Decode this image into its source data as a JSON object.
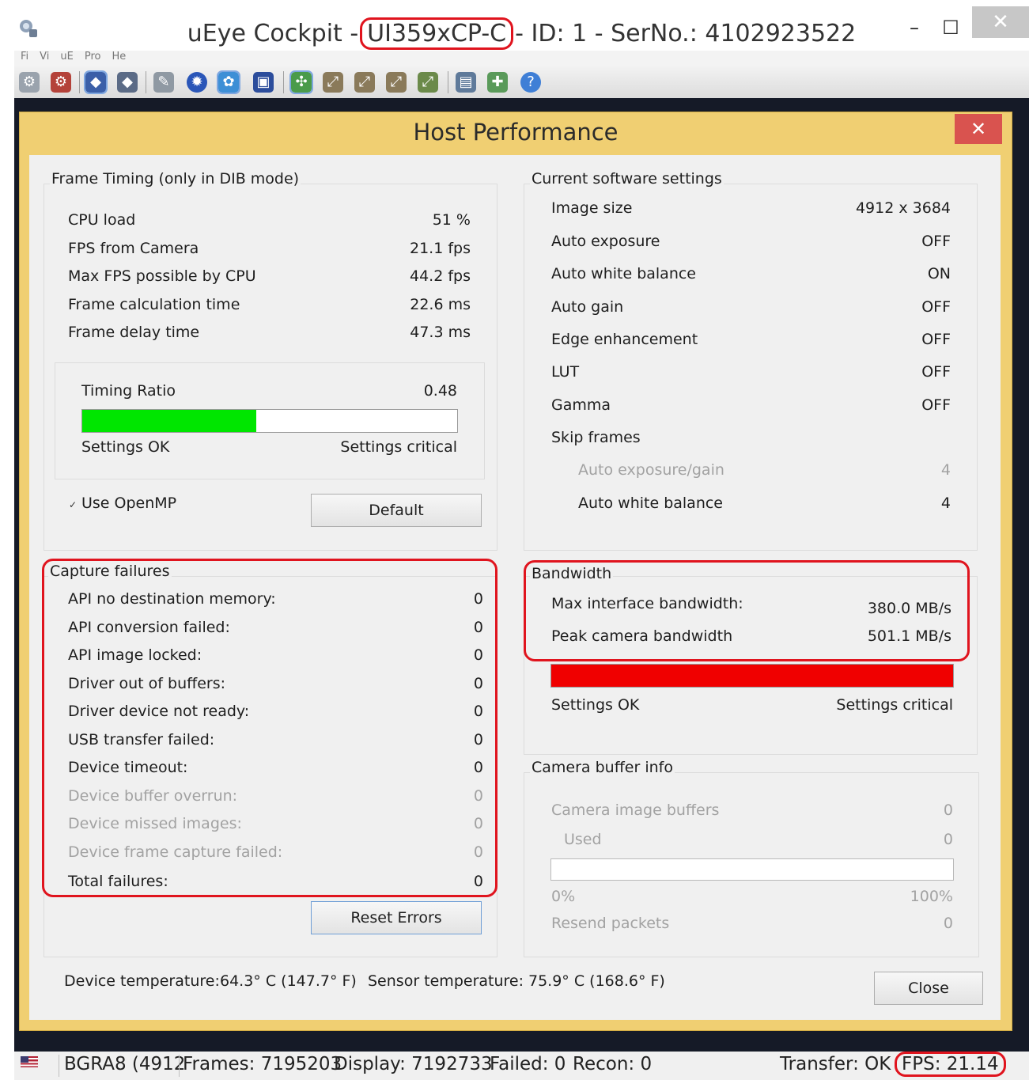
{
  "window": {
    "title_prefix": "uEye Cockpit - ",
    "model": "UI359xCP-C",
    "title_suffix": " - ID: 1 - SerNo.: 4102923522",
    "minimize": "–",
    "maximize": "☐",
    "close": "✕"
  },
  "menu": [
    "Fi",
    "Vi",
    "uE",
    "Pro",
    "He"
  ],
  "dialog": {
    "title": "Host Performance",
    "close": "✕"
  },
  "frame_timing": {
    "title": "Frame Timing (only in DIB mode)",
    "rows": [
      {
        "label": "CPU load",
        "value": "51 %"
      },
      {
        "label": "FPS from Camera",
        "value": "21.1 fps"
      },
      {
        "label": "Max FPS possible by CPU",
        "value": "44.2 fps"
      },
      {
        "label": "Frame calculation time",
        "value": "22.6 ms"
      },
      {
        "label": "Frame delay time",
        "value": "47.3 ms"
      }
    ],
    "timing_ratio_label": "Timing Ratio",
    "timing_ratio_value": "0.48",
    "timing_ratio_fraction": 0.465,
    "ok_label": "Settings OK",
    "critical_label": "Settings critical",
    "openmp_label": "Use OpenMP",
    "openmp_checked": true,
    "default_button": "Default"
  },
  "software_settings": {
    "title": "Current software settings",
    "rows": [
      {
        "label": "Image size",
        "value": "4912 x 3684"
      },
      {
        "label": "Auto exposure",
        "value": "OFF"
      },
      {
        "label": "Auto white balance",
        "value": "ON"
      },
      {
        "label": "Auto gain",
        "value": "OFF"
      },
      {
        "label": "Edge enhancement",
        "value": "OFF"
      },
      {
        "label": "LUT",
        "value": "OFF"
      },
      {
        "label": "Gamma",
        "value": "OFF"
      }
    ],
    "skip_frames_label": "Skip frames",
    "skip_rows": [
      {
        "label": "Auto exposure/gain",
        "value": "4",
        "disabled": true
      },
      {
        "label": "Auto white balance",
        "value": "4",
        "disabled": false
      }
    ]
  },
  "capture_failures": {
    "title": "Capture failures",
    "rows": [
      {
        "label": "API no destination memory:",
        "value": "0",
        "disabled": false
      },
      {
        "label": "API conversion failed:",
        "value": "0",
        "disabled": false
      },
      {
        "label": "API image locked:",
        "value": "0",
        "disabled": false
      },
      {
        "label": "Driver out of buffers:",
        "value": "0",
        "disabled": false
      },
      {
        "label": "Driver device not ready:",
        "value": "0",
        "disabled": false
      },
      {
        "label": "USB transfer failed:",
        "value": "0",
        "disabled": false
      },
      {
        "label": "Device timeout:",
        "value": "0",
        "disabled": false
      },
      {
        "label": "Device buffer overrun:",
        "value": "0",
        "disabled": true
      },
      {
        "label": "Device missed images:",
        "value": "0",
        "disabled": true
      },
      {
        "label": "Device frame capture failed:",
        "value": "0",
        "disabled": true
      },
      {
        "label": "Total failures:",
        "value": "0",
        "disabled": false
      }
    ],
    "reset_button": "Reset Errors"
  },
  "bandwidth": {
    "title": "Bandwidth",
    "rows": [
      {
        "label": "Max interface bandwidth:",
        "value": "380.0 MB/s"
      },
      {
        "label": "Peak camera bandwidth",
        "value": "501.1 MB/s"
      }
    ],
    "fill_fraction": 1.0,
    "ok_label": "Settings OK",
    "critical_label": "Settings critical"
  },
  "camera_buffer": {
    "title": "Camera buffer info",
    "image_buffers_label": "Camera image buffers",
    "image_buffers_value": "0",
    "used_label": "Used",
    "used_value": "0",
    "used_fraction": 0,
    "min_label": "0%",
    "max_label": "100%",
    "resend_label": "Resend packets",
    "resend_value": "0"
  },
  "temperature": {
    "device_label": "Device temperature:",
    "device_value": "64.3° C  (147.7° F)",
    "sensor_label": "Sensor temperature:",
    "sensor_value": "75.9° C  (168.6° F)"
  },
  "close_button": "Close",
  "status": {
    "format": "BGRA8 (4912",
    "frames": "Frames: 7195203",
    "display": "Display: 7192733",
    "failed": "Failed: 0",
    "recon": "Recon: 0",
    "transfer": "Transfer: OK",
    "fps": "FPS: 21.14"
  },
  "colors": {
    "accent_yellow": "#f0cf72",
    "ok_green": "#00e600",
    "critical_red": "#f00000",
    "highlight_red": "#e0141e"
  }
}
